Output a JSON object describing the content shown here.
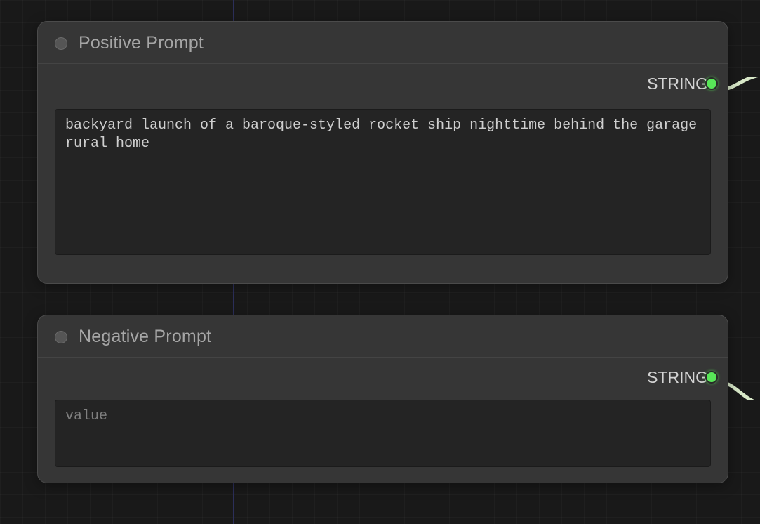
{
  "nodes": {
    "positive": {
      "title": "Positive Prompt",
      "output_label": "STRING",
      "value": "backyard launch of a baroque-styled rocket ship nighttime behind the garage rural home",
      "placeholder": "value"
    },
    "negative": {
      "title": "Negative Prompt",
      "output_label": "STRING",
      "value": "",
      "placeholder": "value"
    }
  },
  "colors": {
    "port": "#58e858"
  }
}
